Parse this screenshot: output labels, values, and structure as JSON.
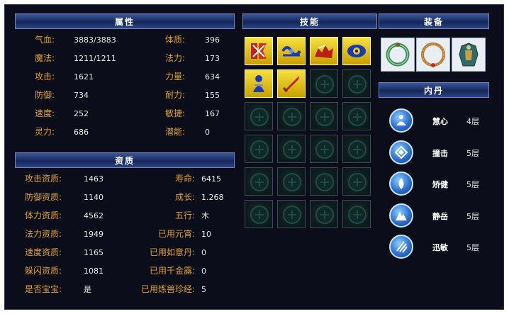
{
  "attributes": {
    "title": "属性",
    "left": [
      {
        "label": "气血:",
        "value": "3883/3883"
      },
      {
        "label": "魔法:",
        "value": "1211/1211"
      },
      {
        "label": "攻击:",
        "value": "1621"
      },
      {
        "label": "防御:",
        "value": "734"
      },
      {
        "label": "速度:",
        "value": "252"
      },
      {
        "label": "灵力:",
        "value": "686"
      }
    ],
    "right": [
      {
        "label": "体质:",
        "value": "396"
      },
      {
        "label": "法力:",
        "value": "173"
      },
      {
        "label": "力量:",
        "value": "634"
      },
      {
        "label": "耐力:",
        "value": "155"
      },
      {
        "label": "敏捷:",
        "value": "167"
      },
      {
        "label": "潜能:",
        "value": "0"
      }
    ]
  },
  "aptitude": {
    "title": "资质",
    "left": [
      {
        "label": "攻击资质:",
        "value": "1463"
      },
      {
        "label": "防御资质:",
        "value": "1140"
      },
      {
        "label": "体力资质:",
        "value": "4562"
      },
      {
        "label": "法力资质:",
        "value": "1949"
      },
      {
        "label": "速度资质:",
        "value": "1165"
      },
      {
        "label": "躲闪资质:",
        "value": "1081"
      },
      {
        "label": "是否宝宝:",
        "value": "是"
      }
    ],
    "right": [
      {
        "label": "寿命:",
        "value": "6415"
      },
      {
        "label": "成长:",
        "value": "1.268"
      },
      {
        "label": "五行:",
        "value": "木"
      },
      {
        "label": "已用元宵:",
        "value": "10"
      },
      {
        "label": "已用如意丹:",
        "value": "0"
      },
      {
        "label": "已用千金露:",
        "value": "0"
      },
      {
        "label": "已用炼兽珍经:",
        "value": "5"
      }
    ]
  },
  "skills": {
    "title": "技能",
    "icons": [
      "red-rune-skill-icon",
      "blue-chain-skill-icon",
      "red-beast-skill-icon",
      "blue-eye-skill-icon",
      "blue-figure-skill-icon",
      "red-sword-skill-icon"
    ]
  },
  "equipment": {
    "title": "装备",
    "items": [
      "jade-ring-icon",
      "gold-necklace-icon",
      "armor-icon"
    ]
  },
  "inner_dan": {
    "title": "内丹",
    "items": [
      {
        "name": "慧心",
        "level": "4层",
        "icon": "meditation-icon"
      },
      {
        "name": "撞击",
        "level": "5层",
        "icon": "impact-icon"
      },
      {
        "name": "矫健",
        "level": "5层",
        "icon": "water-drop-icon"
      },
      {
        "name": "静岳",
        "level": "5层",
        "icon": "mountain-icon"
      },
      {
        "name": "迅敏",
        "level": "5层",
        "icon": "swift-claw-icon"
      }
    ]
  },
  "colors": {
    "panel": "#0b0e1a",
    "label": "#e0a030",
    "value": "#e8e8e8",
    "header": "#1c3068",
    "skill_gold": "#e8c820"
  }
}
